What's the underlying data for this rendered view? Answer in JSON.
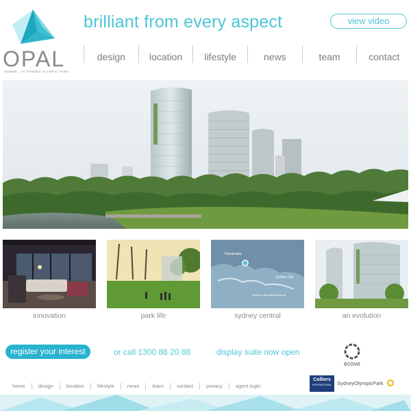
{
  "brand": {
    "name": "OPAL",
    "subline": "TOWER · AT SYDNEY OLYMPIC PARK"
  },
  "header": {
    "tagline": "brilliant from every aspect",
    "video_button": "view video"
  },
  "nav": {
    "items": [
      "design",
      "location",
      "lifestyle",
      "news",
      "team",
      "contact"
    ]
  },
  "tiles": [
    {
      "caption": "innovation",
      "icon": "interior-photo"
    },
    {
      "caption": "park life",
      "icon": "park-photo"
    },
    {
      "caption": "sydney central",
      "icon": "map-photo"
    },
    {
      "caption": "an evolution",
      "icon": "towers-photo"
    }
  ],
  "map_labels": {
    "parramatta": "Parramatta",
    "sydney_city": "Sydney City",
    "airport": "Sydney International Airport"
  },
  "cta": {
    "register": "register your interest",
    "call": "or call 1300 88 20 88",
    "display": "display suite now open",
    "ecove": "ecove"
  },
  "footer": {
    "links": [
      "home",
      "design",
      "location",
      "lifestyle",
      "news",
      "team",
      "contact",
      "privacy",
      "agent login"
    ],
    "partner1": "Colliers",
    "partner1_sub": "INTERNATIONAL",
    "partner2": "SydneyOlympicPark"
  },
  "colors": {
    "accent": "#4ac6d6",
    "button": "#29b3cf",
    "text": "#8a8a8a"
  }
}
